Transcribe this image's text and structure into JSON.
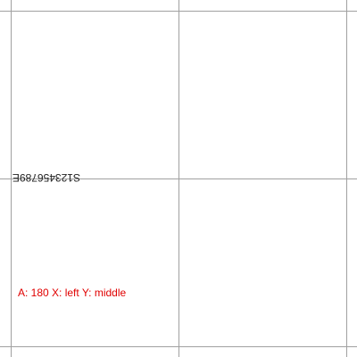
{
  "sample_text": "S123456789E",
  "info_label": "A: 180 X: left Y: middle",
  "colors": {
    "grid": "#a0a0a0",
    "text": "#222222",
    "label": "#e00000"
  }
}
